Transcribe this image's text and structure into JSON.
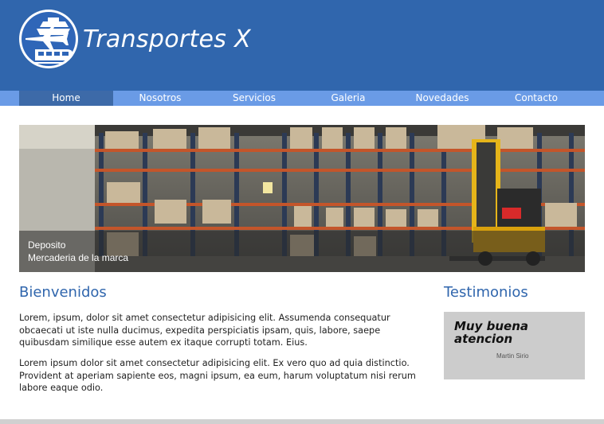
{
  "header": {
    "logo_icon": "plane-ship-train-logo",
    "title": "Transportes X",
    "background_color": "#3066ad"
  },
  "nav": {
    "items": [
      {
        "label": "Home",
        "active": true
      },
      {
        "label": "Nosotros",
        "active": false
      },
      {
        "label": "Servicios",
        "active": false
      },
      {
        "label": "Galeria",
        "active": false
      },
      {
        "label": "Novedades",
        "active": false
      },
      {
        "label": "Contacto",
        "active": false
      }
    ],
    "background_color": "#6a9be6",
    "active_color": "#3d6aa8"
  },
  "banner": {
    "image_subject": "warehouse-forklift-photo",
    "caption_title": "Deposito",
    "caption_subtitle": "Mercaderia de la marca"
  },
  "welcome": {
    "title": "Bienvenidos",
    "paragraph1": "Lorem, ipsum, dolor sit amet consectetur adipisicing elit. Assumenda consequatur obcaecati ut iste nulla ducimus, expedita perspiciatis ipsam, quis, labore, saepe quibusdam similique esse autem ex itaque corrupti totam. Eius.",
    "paragraph2": "Lorem ipsum dolor sit amet consectetur adipisicing elit. Ex vero quo ad quia distinctio. Provident at aperiam sapiente eos, magni ipsum, ea eum, harum voluptatum nisi rerum labore eaque odio."
  },
  "testimonials": {
    "title": "Testimonios",
    "quote": "Muy buena atencion",
    "author": "Martin Sirio"
  }
}
